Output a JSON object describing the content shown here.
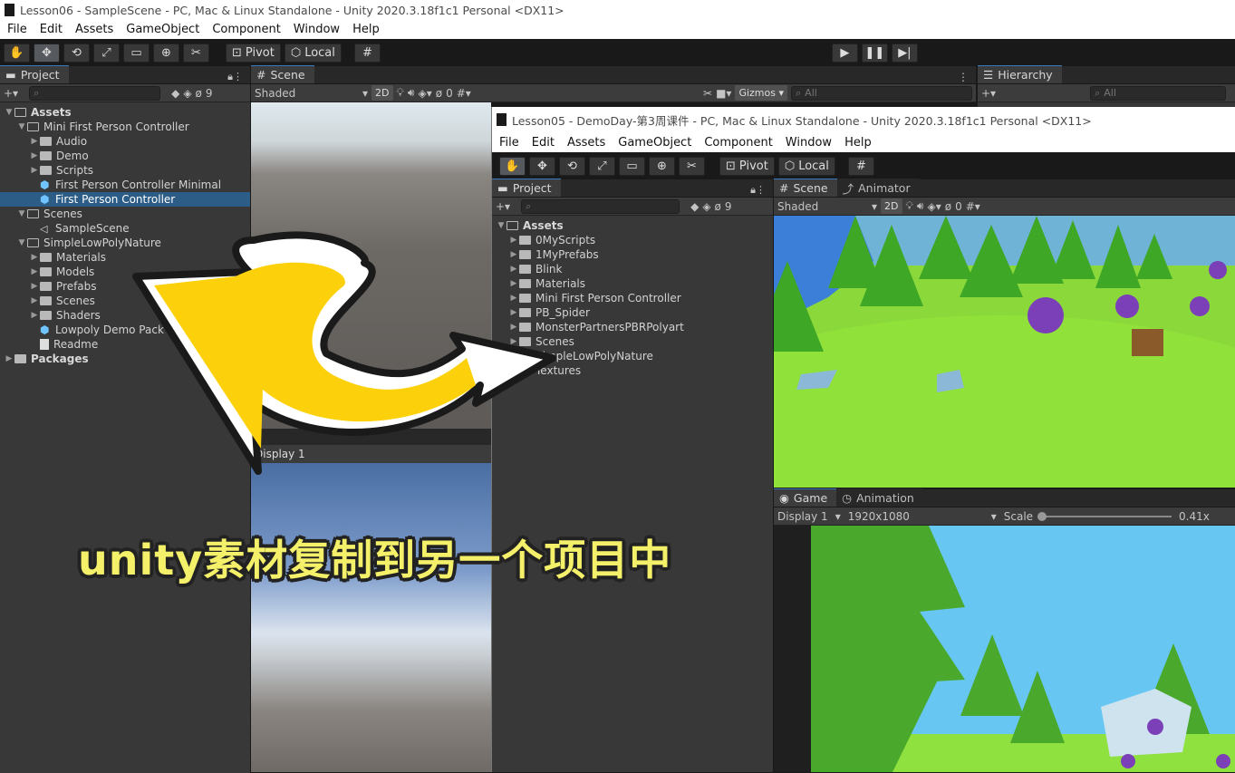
{
  "back": {
    "title": "Lesson06 - SampleScene - PC, Mac & Linux Standalone - Unity 2020.3.18f1c1 Personal <DX11>",
    "menu": [
      "File",
      "Edit",
      "Assets",
      "GameObject",
      "Component",
      "Window",
      "Help"
    ],
    "pivot": "Pivot",
    "local": "Local",
    "project_tab": "Project",
    "scene_tab": "Scene",
    "hierarchy_tab": "Hierarchy",
    "shaded": "Shaded",
    "twod": "2D",
    "gizmos": "Gizmos",
    "all_placeholder": "All",
    "hidden_count": "9",
    "layer_count": "0",
    "game_display": "Display 1",
    "tree": [
      {
        "label": "Assets",
        "depth": 0,
        "type": "folder-open",
        "bold": true
      },
      {
        "label": "Mini First Person Controller",
        "depth": 1,
        "type": "folder-open"
      },
      {
        "label": "Audio",
        "depth": 2,
        "type": "folder"
      },
      {
        "label": "Demo",
        "depth": 2,
        "type": "folder"
      },
      {
        "label": "Scripts",
        "depth": 2,
        "type": "folder"
      },
      {
        "label": "First Person Controller Minimal",
        "depth": 2,
        "type": "prefab"
      },
      {
        "label": "First Person Controller",
        "depth": 2,
        "type": "prefab",
        "selected": true
      },
      {
        "label": "Scenes",
        "depth": 1,
        "type": "folder-open"
      },
      {
        "label": "SampleScene",
        "depth": 2,
        "type": "scene"
      },
      {
        "label": "SimpleLowPolyNature",
        "depth": 1,
        "type": "folder-open"
      },
      {
        "label": "Materials",
        "depth": 2,
        "type": "folder"
      },
      {
        "label": "Models",
        "depth": 2,
        "type": "folder"
      },
      {
        "label": "Prefabs",
        "depth": 2,
        "type": "folder"
      },
      {
        "label": "Scenes",
        "depth": 2,
        "type": "folder"
      },
      {
        "label": "Shaders",
        "depth": 2,
        "type": "folder"
      },
      {
        "label": "Lowpoly Demo Pack",
        "depth": 2,
        "type": "prefab"
      },
      {
        "label": "Readme",
        "depth": 2,
        "type": "doc"
      },
      {
        "label": "Packages",
        "depth": 0,
        "type": "folder",
        "bold": true
      }
    ]
  },
  "front": {
    "title": "Lesson05 - DemoDay-第3周课件 - PC, Mac & Linux Standalone - Unity 2020.3.18f1c1 Personal <DX11>",
    "menu": [
      "File",
      "Edit",
      "Assets",
      "GameObject",
      "Component",
      "Window",
      "Help"
    ],
    "pivot": "Pivot",
    "local": "Local",
    "project_tab": "Project",
    "scene_tab": "Scene",
    "animator_tab": "Animator",
    "game_tab": "Game",
    "animation_tab": "Animation",
    "shaded": "Shaded",
    "twod": "2D",
    "hidden_count": "9",
    "layer_count": "0",
    "display": "Display 1",
    "resolution": "1920x1080",
    "scale_label": "Scale",
    "scale_value": "0.41x",
    "tree": [
      {
        "label": "Assets",
        "depth": 0,
        "type": "folder-open",
        "bold": true
      },
      {
        "label": "0MyScripts",
        "depth": 1,
        "type": "folder"
      },
      {
        "label": "1MyPrefabs",
        "depth": 1,
        "type": "folder"
      },
      {
        "label": "Blink",
        "depth": 1,
        "type": "folder"
      },
      {
        "label": "Materials",
        "depth": 1,
        "type": "folder"
      },
      {
        "label": "Mini First Person Controller",
        "depth": 1,
        "type": "folder"
      },
      {
        "label": "PB_Spider",
        "depth": 1,
        "type": "folder"
      },
      {
        "label": "MonsterPartnersPBRPolyart",
        "depth": 1,
        "type": "folder"
      },
      {
        "label": "Scenes",
        "depth": 1,
        "type": "folder"
      },
      {
        "label": "SimpleLowPolyNature",
        "depth": 1,
        "type": "folder"
      },
      {
        "label": "Textures",
        "depth": 1,
        "type": "folder"
      }
    ]
  },
  "caption": "unity素材复制到另一个项目中"
}
